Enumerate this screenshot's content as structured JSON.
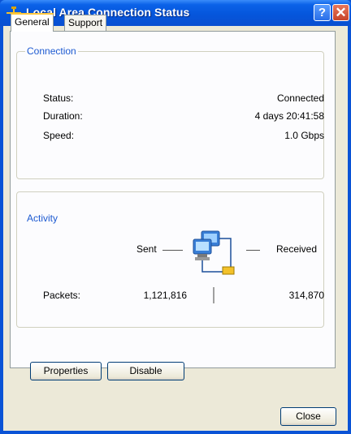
{
  "window": {
    "title": "Local Area Connection Status"
  },
  "titlebar": {
    "help_label": "?",
    "close_label": "✕"
  },
  "tabs": [
    {
      "label": "General"
    },
    {
      "label": "Support"
    }
  ],
  "connection": {
    "group_label": "Connection",
    "status_label": "Status:",
    "status_value": "Connected",
    "duration_label": "Duration:",
    "duration_value": "4 days 20:41:58",
    "speed_label": "Speed:",
    "speed_value": "1.0 Gbps"
  },
  "activity": {
    "group_label": "Activity",
    "sent_label": "Sent",
    "received_label": "Received",
    "packets_label": "Packets:",
    "packets_sent": "1,121,816",
    "packets_received": "314,870"
  },
  "buttons": {
    "properties": "Properties",
    "disable": "Disable",
    "close": "Close"
  },
  "icons": {
    "title": "network-connection-icon",
    "activity": "network-computers-icon"
  }
}
